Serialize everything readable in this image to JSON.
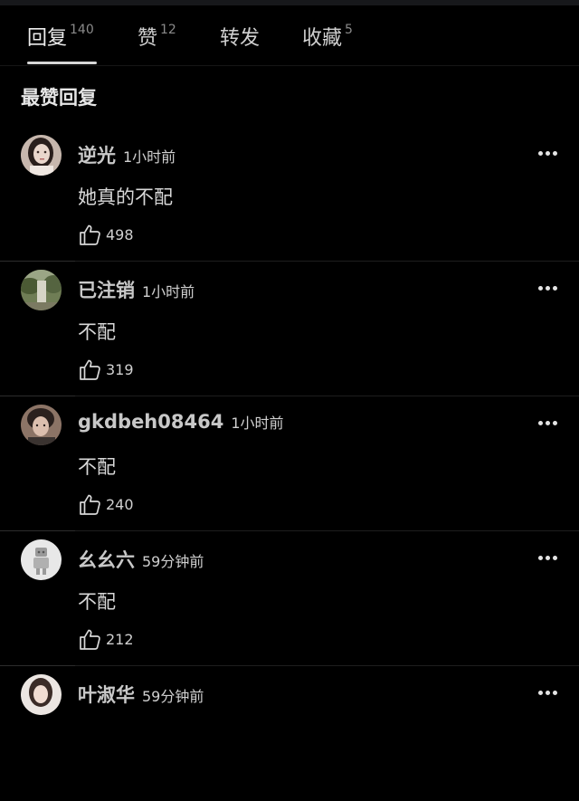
{
  "tabs": [
    {
      "label": "回复",
      "count": "140"
    },
    {
      "label": "赞",
      "count": "12"
    },
    {
      "label": "转发",
      "count": ""
    },
    {
      "label": "收藏",
      "count": "5"
    }
  ],
  "section_title": "最赞回复",
  "comments": [
    {
      "username": "逆光",
      "time": "1小时前",
      "text": "她真的不配",
      "likes": "498",
      "avatar": "girl-avatar"
    },
    {
      "username": "已注销",
      "time": "1小时前",
      "text": "不配",
      "likes": "319",
      "avatar": "landscape-avatar"
    },
    {
      "username": "gkdbeh08464",
      "time": "1小时前",
      "text": "不配",
      "likes": "240",
      "avatar": "portrait-avatar"
    },
    {
      "username": "幺幺六",
      "time": "59分钟前",
      "text": "不配",
      "likes": "212",
      "avatar": "robot-avatar"
    },
    {
      "username": "叶淑华",
      "time": "59分钟前",
      "text": "",
      "likes": "",
      "avatar": "woman-avatar"
    }
  ],
  "colors": {
    "background": "#000000",
    "text": "#d8d8d8",
    "username": "#c8c8c8",
    "muted": "#8a8a8a"
  }
}
